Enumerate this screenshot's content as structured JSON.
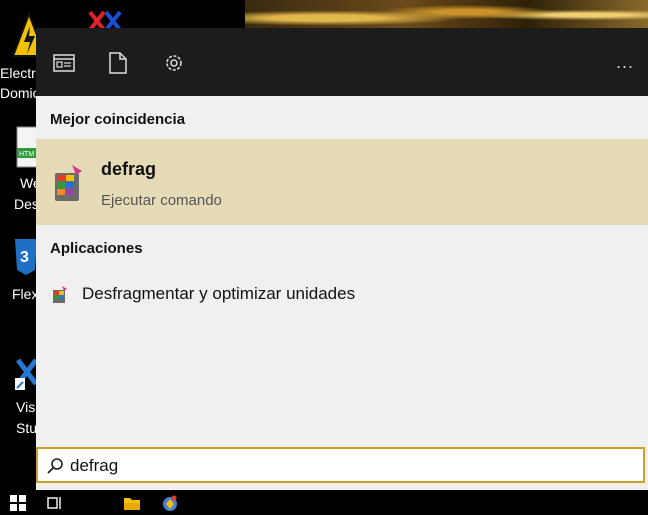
{
  "desktop": {
    "icons": [
      {
        "name": "electrical-app",
        "label_line1": "Electri",
        "label_line2": "Domic"
      },
      {
        "name": "web-app",
        "label_line1": "We",
        "label_line2": "Des"
      },
      {
        "name": "css-app",
        "label_line1": "Flex",
        "label_line2": ""
      },
      {
        "name": "visual-studio",
        "label_line1": "Visu",
        "label_line2": "Stu"
      }
    ]
  },
  "start_panel": {
    "top_icons": [
      "documents-view-icon",
      "file-icon",
      "gear-icon"
    ],
    "more": "...",
    "best_match_heading": "Mejor coincidencia",
    "best_match": {
      "title": "defrag",
      "subtitle": "Ejecutar comando"
    },
    "apps_heading": "Aplicaciones",
    "apps": [
      {
        "label": "Desfragmentar y optimizar unidades"
      }
    ]
  },
  "search": {
    "value": "defrag"
  },
  "taskbar": {
    "items": [
      "windows-start-icon",
      "task-view-icon",
      "file-explorer-icon",
      "app-icon"
    ]
  },
  "colors": {
    "accent": "#c9a227",
    "highlight": "#e5dcb7",
    "panel": "#f0f0f0",
    "header": "#1c1c1c"
  }
}
